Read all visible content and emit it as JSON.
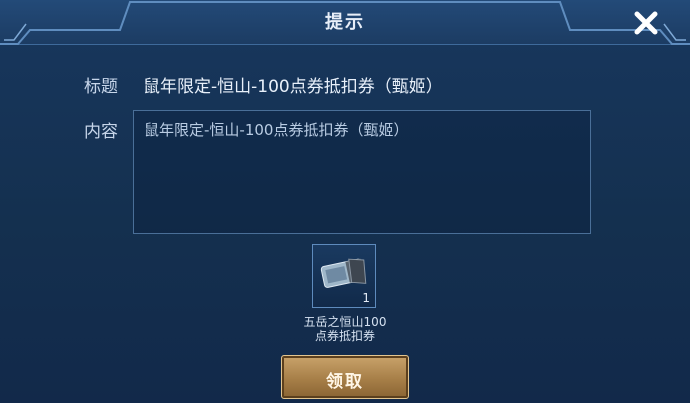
{
  "dialog": {
    "title": "提示"
  },
  "fields": {
    "title_label": "标题",
    "title_value": "鼠年限定-恒山-100点券抵扣券（甄姬）",
    "content_label": "内容",
    "content_value": "鼠年限定-恒山-100点券抵扣券（甄姬）"
  },
  "reward": {
    "count": "1",
    "name": "五岳之恒山100点券抵扣券"
  },
  "actions": {
    "claim_label": "领取"
  },
  "colors": {
    "accent_gold": "#b48a52",
    "panel_blue": "#14304f"
  }
}
